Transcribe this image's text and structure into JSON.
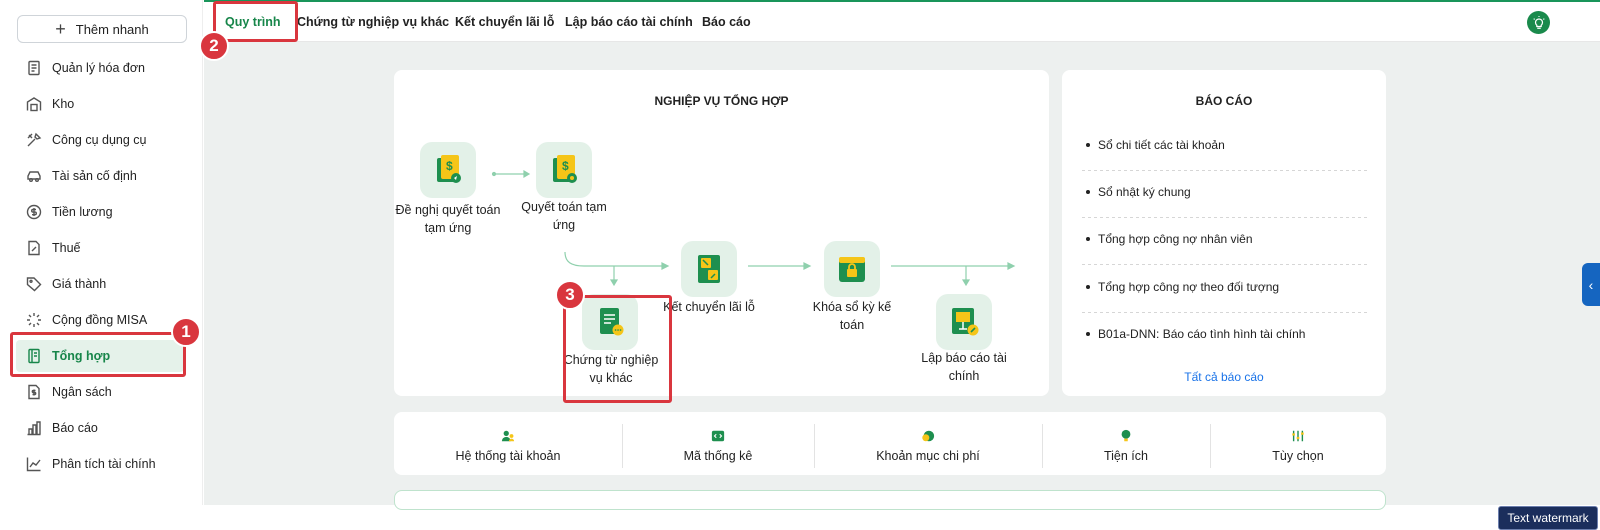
{
  "sidebar": {
    "quick_add": "Thêm nhanh",
    "items": [
      {
        "label": "Quản lý hóa đơn",
        "icon": "invoice-icon"
      },
      {
        "label": "Kho",
        "icon": "warehouse-icon"
      },
      {
        "label": "Công cụ dụng cụ",
        "icon": "tools-icon"
      },
      {
        "label": "Tài sản cố định",
        "icon": "car-icon"
      },
      {
        "label": "Tiền lương",
        "icon": "dollar-icon"
      },
      {
        "label": "Thuế",
        "icon": "tax-icon"
      },
      {
        "label": "Giá thành",
        "icon": "tag-icon"
      },
      {
        "label": "Cộng đồng MISA",
        "icon": "community-icon"
      },
      {
        "label": "Tổng hợp",
        "icon": "book-icon"
      },
      {
        "label": "Ngân sách",
        "icon": "budget-icon"
      },
      {
        "label": "Báo cáo",
        "icon": "bar-chart-icon"
      },
      {
        "label": "Phân tích tài chính",
        "icon": "analytics-icon"
      }
    ],
    "active_index": 8
  },
  "tabs": [
    "Quy trình",
    "Chứng từ nghiệp vụ khác",
    "Kết chuyển lãi lỗ",
    "Lập báo cáo tài chính",
    "Báo cáo"
  ],
  "process": {
    "title": "NGHIỆP VỤ TỔNG HỢP",
    "steps": [
      {
        "label": "Đề nghị quyết toán tạm ứng"
      },
      {
        "label": "Quyết toán tạm ứng"
      },
      {
        "label": "Kết chuyển lãi lỗ"
      },
      {
        "label": "Khóa sổ kỳ kế toán"
      },
      {
        "label": "Chứng từ nghiệp vụ khác"
      },
      {
        "label": "Lập báo cáo tài chính"
      }
    ]
  },
  "reports": {
    "title": "BÁO CÁO",
    "items": [
      "Sổ chi tiết các tài khoản",
      "Sổ nhật ký chung",
      "Tổng hợp công nợ nhân viên",
      "Tổng hợp công nợ theo đối tượng",
      "B01a-DNN: Báo cáo tình hình tài chính"
    ],
    "all_link": "Tất cả báo cáo"
  },
  "utilities": [
    "Hệ thống tài khoản",
    "Mã thống kê",
    "Khoản mục chi phí",
    "Tiện ích",
    "Tùy chọn"
  ],
  "callouts": [
    "1",
    "2",
    "3"
  ],
  "watermark": "Text watermark",
  "colors": {
    "brand": "#17864a",
    "callout": "#d9363e",
    "link": "#1a73e8"
  }
}
